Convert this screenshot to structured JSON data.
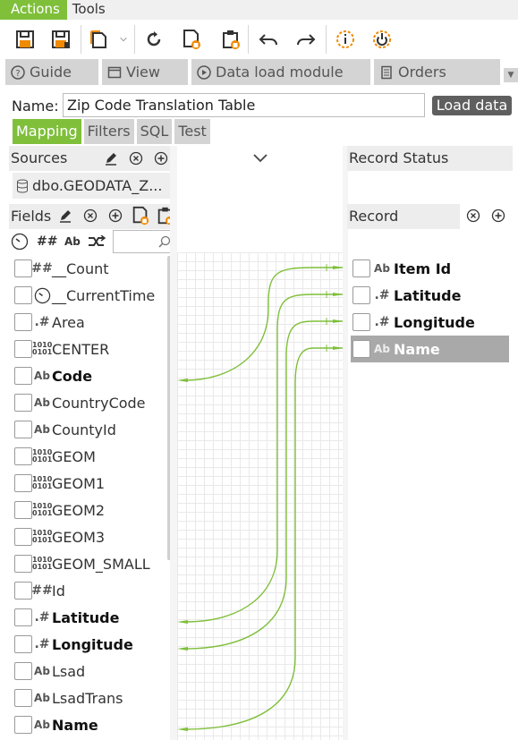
{
  "menu": {
    "items": [
      "Actions",
      "Tools"
    ]
  },
  "toolbar": {
    "buttons": [
      "save-icon",
      "save-as-icon",
      "new-document-icon",
      "dropdown-icon",
      "refresh-icon",
      "export-icon",
      "import-icon",
      "undo-icon",
      "redo-icon",
      "info-icon",
      "power-icon"
    ],
    "colors": {
      "accent": "#7fbf3a",
      "orange": "#f08a00",
      "dark": "#333333"
    }
  },
  "module_tabs": [
    {
      "label": "Guide",
      "icon": "question-icon"
    },
    {
      "label": "View",
      "icon": "window-icon"
    },
    {
      "label": "Data load module",
      "icon": "play-icon"
    },
    {
      "label": "Orders",
      "icon": "document-icon"
    }
  ],
  "name_row": {
    "label": "Name:",
    "value": "Zip Code Translation Table",
    "load_button": "Load data"
  },
  "sub_tabs": [
    "Mapping",
    "Filters",
    "SQL",
    "Test"
  ],
  "sources": {
    "title": "Sources",
    "items": [
      "dbo.GEODATA_Z..."
    ]
  },
  "fields": {
    "title": "Fields",
    "filter_icons": [
      "clock-filter-icon",
      "number-filter-icon",
      "text-filter-icon",
      "link-filter-icon"
    ],
    "filter_labels": [
      "##",
      "Ab"
    ],
    "search_placeholder": "",
    "items": [
      {
        "type": "##",
        "name": "__Count",
        "bold": false
      },
      {
        "type": "clock",
        "name": "__CurrentTime",
        "bold": false
      },
      {
        "type": ".#",
        "name": "Area",
        "bold": false
      },
      {
        "type": "bin",
        "name": "CENTER",
        "bold": false
      },
      {
        "type": "Ab",
        "name": "Code",
        "bold": true
      },
      {
        "type": "Ab",
        "name": "CountryCode",
        "bold": false
      },
      {
        "type": "Ab",
        "name": "CountyId",
        "bold": false
      },
      {
        "type": "bin",
        "name": "GEOM",
        "bold": false
      },
      {
        "type": "bin",
        "name": "GEOM1",
        "bold": false
      },
      {
        "type": "bin",
        "name": "GEOM2",
        "bold": false
      },
      {
        "type": "bin",
        "name": "GEOM3",
        "bold": false
      },
      {
        "type": "bin",
        "name": "GEOM_SMALL",
        "bold": false
      },
      {
        "type": "##",
        "name": "Id",
        "bold": false
      },
      {
        "type": ".#",
        "name": "Latitude",
        "bold": true
      },
      {
        "type": ".#",
        "name": "Longitude",
        "bold": true
      },
      {
        "type": "Ab",
        "name": "Lsad",
        "bold": false
      },
      {
        "type": "Ab",
        "name": "LsadTrans",
        "bold": false
      },
      {
        "type": "Ab",
        "name": "Name",
        "bold": true
      }
    ]
  },
  "record_status": {
    "title": "Record Status"
  },
  "record": {
    "title": "Record",
    "items": [
      {
        "type": "Ab",
        "name": "Item Id",
        "selected": false
      },
      {
        "type": ".#",
        "name": "Latitude",
        "selected": false
      },
      {
        "type": ".#",
        "name": "Longitude",
        "selected": false
      },
      {
        "type": "Ab",
        "name": "Name",
        "selected": true
      }
    ]
  },
  "mappings": [
    {
      "from": "Code",
      "to": "Item Id"
    },
    {
      "from": "Latitude",
      "to": "Latitude"
    },
    {
      "from": "Longitude",
      "to": "Longitude"
    },
    {
      "from": "Name",
      "to": "Name"
    }
  ]
}
